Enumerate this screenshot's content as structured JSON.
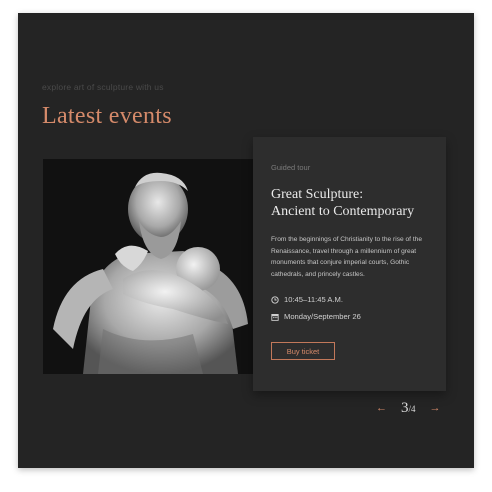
{
  "section": {
    "eyebrow": "explore art of sculpture with us",
    "title": "Latest events"
  },
  "event": {
    "kicker": "Guided tour",
    "title_line1": "Great Sculpture:",
    "title_line2": "Ancient to Contemporary",
    "description": "From the beginnings of Christianity to the rise of the Renaissance, travel through a millennium of great monuments that conjure imperial courts, Gothic cathedrals, and princely castles.",
    "time": "10:45–11:45 A.M.",
    "date": "Monday/September 26",
    "buy_label": "Buy ticket",
    "image_icon": "sculpture-photo"
  },
  "pager": {
    "prev_icon": "←",
    "next_icon": "→",
    "current": "3",
    "total": "/4"
  },
  "colors": {
    "background": "#242424",
    "card": "#2d2d2d",
    "accent": "#d58a6a"
  }
}
